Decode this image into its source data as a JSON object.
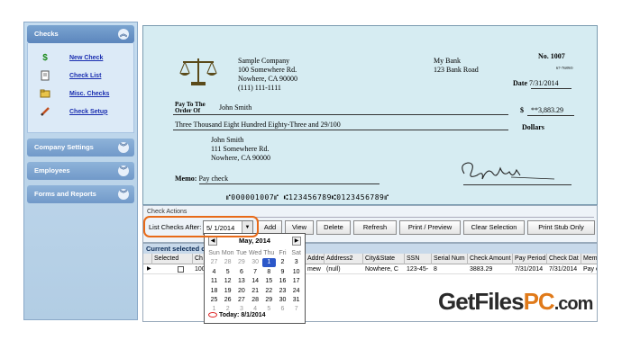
{
  "sidebar": {
    "checks_panel": {
      "title": "Checks",
      "items": [
        {
          "label": "New Check",
          "icon": "dollar-icon"
        },
        {
          "label": "Check List",
          "icon": "document-icon"
        },
        {
          "label": "Misc. Checks",
          "icon": "folder-icon"
        },
        {
          "label": "Check Setup",
          "icon": "pencil-icon"
        }
      ]
    },
    "other_panels": [
      "Company Settings",
      "Employees",
      "Forms and Reports"
    ]
  },
  "check": {
    "company_name": "Sample Company",
    "company_address1": "100 Somewhere Rd.",
    "company_address2": "Nowhere, CA 90000",
    "company_phone": "(111) 111-1111",
    "bank_name": "My Bank",
    "bank_address": "123 Bank Road",
    "number_label": "No.",
    "number": "1007",
    "routing_fraction": "67-7689/0",
    "date_label": "Date",
    "date": "7/31/2014",
    "pay_to_label": "Pay To The",
    "order_of_label": "Order Of",
    "payee": "John Smith",
    "currency_symbol": "$",
    "amount": "**3,883.29",
    "amount_words": "Three Thousand Eight Hundred Eighty-Three and 29/100",
    "dollars_label": "Dollars",
    "address_name": "John Smith",
    "address_line1": "111 Somewhere Rd.",
    "address_line2": "Nowhere, CA 90000",
    "memo_label": "Memo:",
    "memo": "Pay check",
    "micr_line": "⑈000001007⑈ ⑆123456789⑆0123456789⑈"
  },
  "actions": {
    "group_title": "Check Actions",
    "filter_label": "List Checks After:",
    "filter_value": "5/ 1/2014",
    "buttons": [
      "Add",
      "View",
      "Delete",
      "Refresh",
      "Print / Preview",
      "Clear Selection",
      "Print Stub Only"
    ]
  },
  "table": {
    "title": "Current selected c",
    "columns": [
      "Selected",
      "Ch",
      "Address1",
      "Address2",
      "City&State",
      "SSN",
      "Serial Num",
      "Check Amount",
      "Pay Period",
      "Check Dat",
      "Memo"
    ],
    "rows": [
      [
        "",
        "100",
        "mew",
        "(null)",
        "Nowhere, C",
        "123-45-",
        "8",
        "3883.29",
        "7/31/2014",
        "7/31/2014",
        "Pay c"
      ]
    ]
  },
  "calendar": {
    "title": "May, 2014",
    "prev_label": "◀",
    "next_label": "▶",
    "weekdays": [
      "Sun",
      "Mon",
      "Tue",
      "Wed",
      "Thu",
      "Fri",
      "Sat"
    ],
    "weeks": [
      [
        "27",
        "28",
        "29",
        "30",
        "1",
        "2",
        "3"
      ],
      [
        "4",
        "5",
        "6",
        "7",
        "8",
        "9",
        "10"
      ],
      [
        "11",
        "12",
        "13",
        "14",
        "15",
        "16",
        "17"
      ],
      [
        "18",
        "19",
        "20",
        "21",
        "22",
        "23",
        "24"
      ],
      [
        "25",
        "26",
        "27",
        "28",
        "29",
        "30",
        "31"
      ],
      [
        "1",
        "2",
        "3",
        "4",
        "5",
        "6",
        "7"
      ]
    ],
    "selected_day": "1",
    "today_label": "Today: 8/1/2014"
  },
  "watermark": {
    "part1": "GetFiles",
    "part2": "PC",
    "part3": ".com"
  },
  "colors": {
    "sidebar_header": "#5c86bd",
    "link": "#1a2eb0",
    "check_bg": "#d6ecf2",
    "highlight": "#e86a18",
    "calendar_selected": "#2b57c9"
  }
}
